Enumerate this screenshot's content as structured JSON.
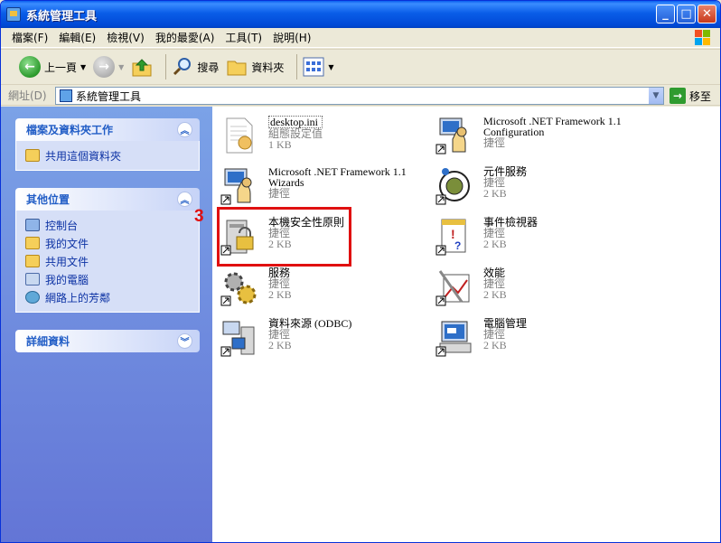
{
  "window": {
    "title": "系統管理工具"
  },
  "menu": [
    "檔案(F)",
    "編輯(E)",
    "檢視(V)",
    "我的最愛(A)",
    "工具(T)",
    "說明(H)"
  ],
  "toolbar": {
    "back": "上一頁",
    "search": "搜尋",
    "folders": "資料夾"
  },
  "address": {
    "label": "網址(D)",
    "value": "系統管理工具",
    "go": "移至"
  },
  "tasks": {
    "file_tasks": {
      "title": "檔案及資料夾工作",
      "items": [
        "共用這個資料夾"
      ]
    },
    "other_places": {
      "title": "其他位置",
      "items": [
        "控制台",
        "我的文件",
        "共用文件",
        "我的電腦",
        "網路上的芳鄰"
      ]
    },
    "details": {
      "title": "詳細資料"
    }
  },
  "files": [
    {
      "name": "desktop.ini",
      "line2": "組態設定值",
      "line3": "1 KB",
      "icon": "ini-file-icon"
    },
    {
      "name": "Microsoft .NET Framework 1.1",
      "line2": "Configuration",
      "line3": "捷徑",
      "icon": "dotnet-config-icon"
    },
    {
      "name": "Microsoft .NET Framework 1.1",
      "line2": "Wizards",
      "line3": "捷徑",
      "icon": "dotnet-wizards-icon"
    },
    {
      "name": "元件服務",
      "line2": "捷徑",
      "line3": "2 KB",
      "icon": "component-services-icon"
    },
    {
      "name": "本機安全性原則",
      "line2": "捷徑",
      "line3": "2 KB",
      "icon": "local-security-policy-icon"
    },
    {
      "name": "事件檢視器",
      "line2": "捷徑",
      "line3": "2 KB",
      "icon": "event-viewer-icon"
    },
    {
      "name": "服務",
      "line2": "捷徑",
      "line3": "2 KB",
      "icon": "services-icon"
    },
    {
      "name": "效能",
      "line2": "捷徑",
      "line3": "2 KB",
      "icon": "performance-icon"
    },
    {
      "name": "資料來源 (ODBC)",
      "line2": "捷徑",
      "line3": "2 KB",
      "icon": "odbc-icon"
    },
    {
      "name": "電腦管理",
      "line2": "捷徑",
      "line3": "2 KB",
      "icon": "computer-management-icon"
    }
  ],
  "annotation": {
    "label": "3"
  }
}
